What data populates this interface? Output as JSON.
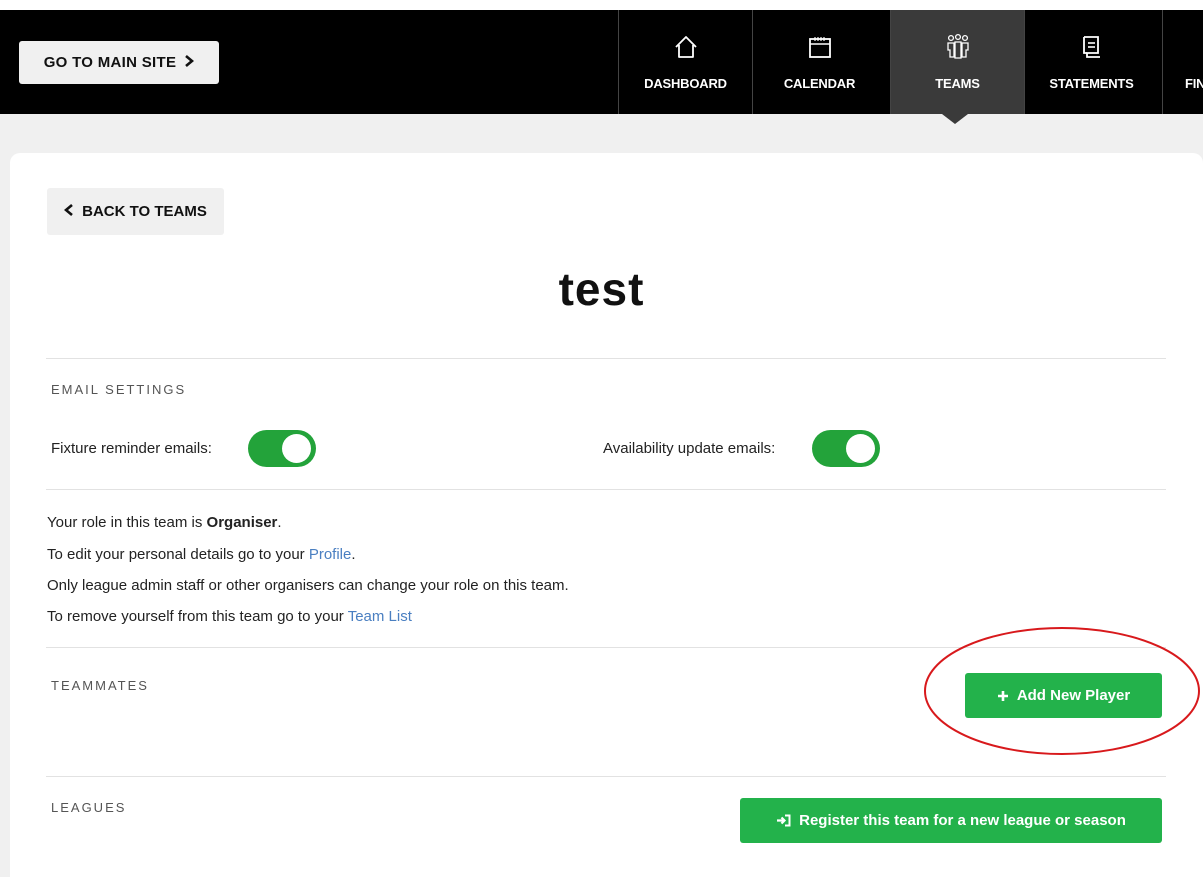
{
  "topbar": {
    "main_site_label": "GO TO MAIN SITE",
    "nav": [
      {
        "label": "DASHBOARD",
        "icon": "home-icon"
      },
      {
        "label": "CALENDAR",
        "icon": "calendar-icon"
      },
      {
        "label": "TEAMS",
        "icon": "teams-icon",
        "active": true
      },
      {
        "label": "STATEMENTS",
        "icon": "statements-icon"
      },
      {
        "label": "FIN",
        "icon": ""
      }
    ]
  },
  "page": {
    "back_label": "BACK TO TEAMS",
    "team_name": "test"
  },
  "email_settings": {
    "heading": "EMAIL SETTINGS",
    "fixture_label": "Fixture reminder emails:",
    "fixture_on": true,
    "availability_label": "Availability update emails:",
    "availability_on": true
  },
  "role_info": {
    "role_prefix": "Your role in this team is ",
    "role": "Organiser",
    "role_suffix": ".",
    "profile_prefix": "To edit your personal details go to your ",
    "profile_link": "Profile",
    "profile_suffix": ".",
    "admin_note": "Only league admin staff or other organisers can change your role on this team.",
    "remove_prefix": "To remove yourself from this team go to your ",
    "team_list_link": "Team List"
  },
  "teammates": {
    "heading": "TEAMMATES",
    "add_player_label": "Add New Player"
  },
  "leagues": {
    "heading": "LEAGUES",
    "register_label": "Register this team for a new league or season"
  },
  "colors": {
    "green": "#23b24b",
    "toggle_green": "#23a33a",
    "link_blue": "#4a7fc1",
    "annotation_red": "#d8191c"
  }
}
